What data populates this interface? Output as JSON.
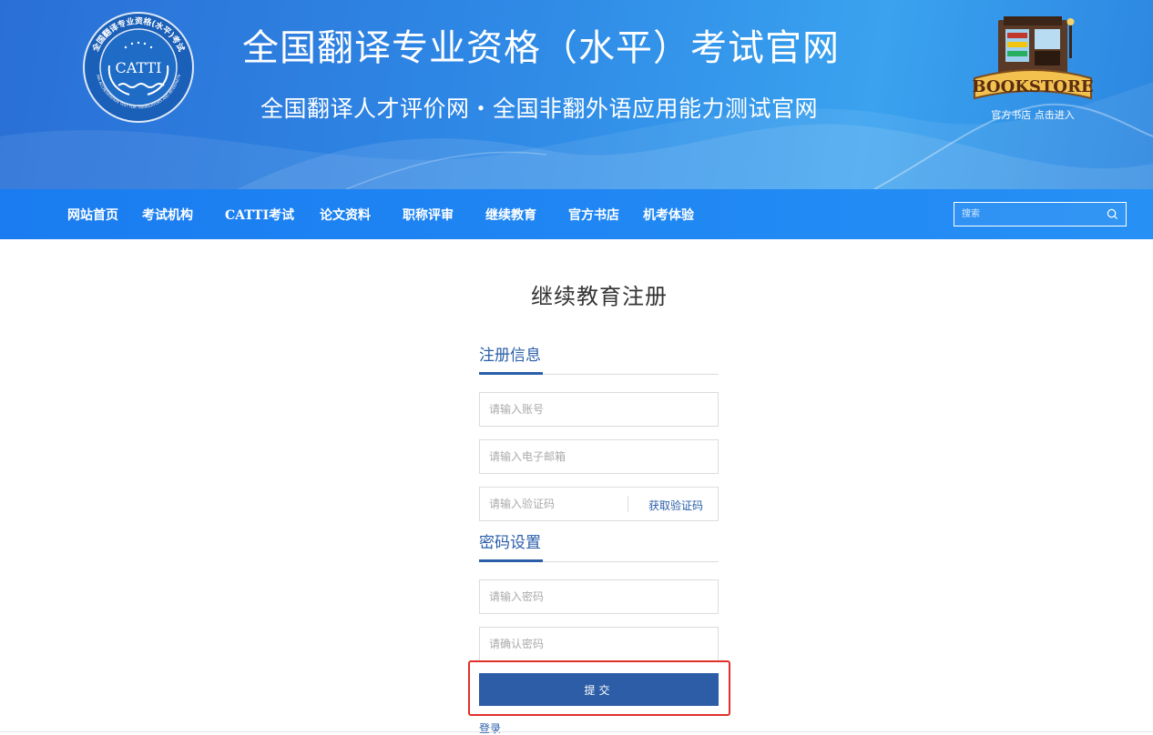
{
  "header": {
    "title": "全国翻译专业资格（水平）考试官网",
    "subtitle": "全国翻译人才评价网・全国非翻外语应用能力测试官网",
    "logo": {
      "center_text": "CATTI",
      "ring_text": "全国翻译专业资格(水平)考试",
      "ring_text_en": "CHINA ACCREDITATION TEST FOR TRANSLATORS AND INTERPRETERS"
    },
    "bookstore": {
      "sign_text": "BOOKSTORE",
      "caption": "官方书店 点击进入"
    }
  },
  "nav": {
    "items": [
      "网站首页",
      "考试机构",
      "CATTI考试",
      "论文资料",
      "职称评审",
      "继续教育",
      "官方书店",
      "机考体验"
    ],
    "search_placeholder": "搜索"
  },
  "form": {
    "title": "继续教育注册",
    "section_register": "注册信息",
    "account_placeholder": "请输入账号",
    "email_placeholder": "请输入电子邮箱",
    "code_placeholder": "请输入验证码",
    "get_code_label": "获取验证码",
    "section_password": "密码设置",
    "password_placeholder": "请输入密码",
    "confirm_placeholder": "请确认密码",
    "submit_label": "提交",
    "login_label": "登录"
  },
  "colors": {
    "banner": "#2f8ae6",
    "nav": "#1f86f3",
    "accent": "#2a5ea8",
    "submit": "#2d5da6",
    "highlight": "#e0302a"
  }
}
